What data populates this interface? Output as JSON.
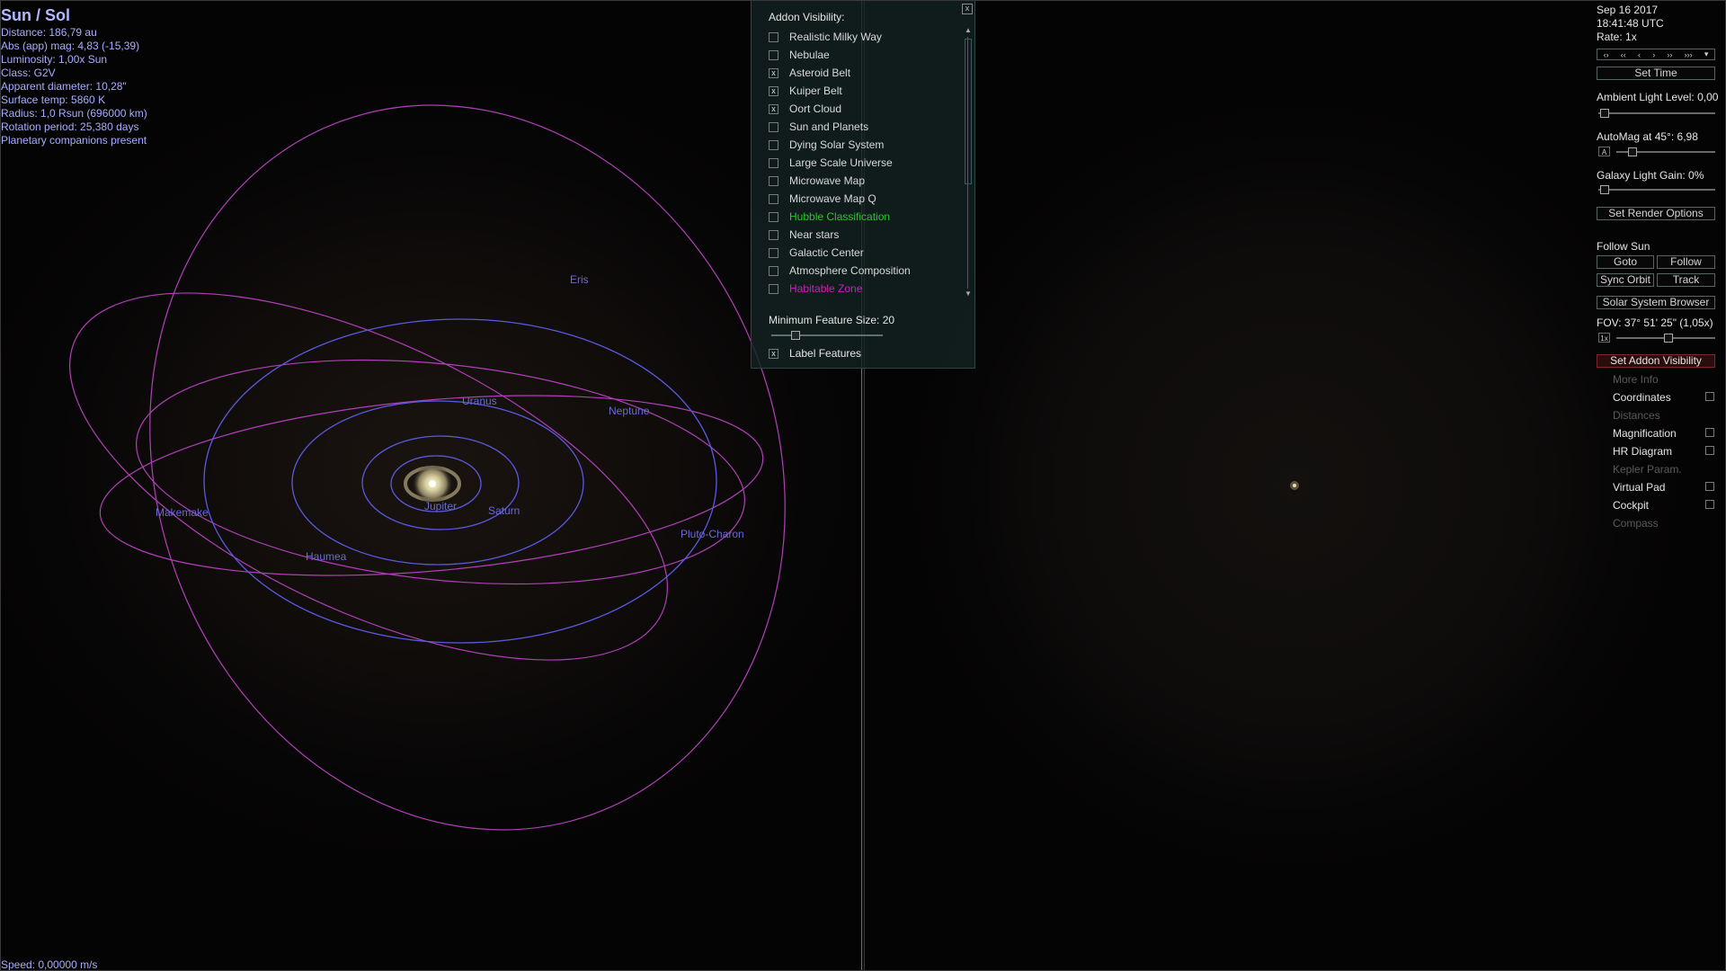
{
  "object_info": {
    "title": "Sun / Sol",
    "lines": [
      "Distance: 186,79 au",
      "Abs (app) mag: 4,83 (-15,39)",
      "Luminosity: 1,00x Sun",
      "Class: G2V",
      "Apparent diameter: 10,28\"",
      "Surface temp: 5860 K",
      "Radius: 1,0 Rsun  (696000 km)",
      "Rotation period: 25,380 days",
      "Planetary companions present"
    ]
  },
  "speed": "Speed: 0,00000 m/s",
  "orbit_labels": {
    "eris": "Eris",
    "uranus": "Uranus",
    "neptune": "Neptune",
    "jupiter": "Jupiter",
    "saturn": "Saturn",
    "makemake": "Makemake",
    "haumea": "Haumea",
    "pluto": "Pluto-Charon"
  },
  "colors": {
    "planet_orbit": "#5a5ae0",
    "dwarf_orbit": "#b040b8",
    "hubble": "#2ec42e",
    "habitable": "#d21cc0"
  },
  "addon_panel": {
    "heading": "Addon Visibility:",
    "close": "x",
    "items": [
      {
        "label": "Realistic Milky Way",
        "checked": false
      },
      {
        "label": "Nebulae",
        "checked": false
      },
      {
        "label": "Asteroid Belt",
        "checked": true
      },
      {
        "label": "Kuiper Belt",
        "checked": true
      },
      {
        "label": "Oort Cloud",
        "checked": true
      },
      {
        "label": "Sun and Planets",
        "checked": false
      },
      {
        "label": "Dying Solar System",
        "checked": false
      },
      {
        "label": "Large Scale Universe",
        "checked": false
      },
      {
        "label": "Microwave Map",
        "checked": false
      },
      {
        "label": "Microwave Map Q",
        "checked": false
      },
      {
        "label": "Hubble Classification",
        "checked": false,
        "color": "#2ec42e"
      },
      {
        "label": "Near stars",
        "checked": false
      },
      {
        "label": "Galactic Center",
        "checked": false
      },
      {
        "label": "Atmosphere Composition",
        "checked": false
      },
      {
        "label": "Habitable Zone",
        "checked": false,
        "color": "#d21cc0"
      }
    ],
    "min_feature_label": "Minimum Feature Size: 20",
    "label_features": {
      "label": "Label Features",
      "checked": true
    }
  },
  "control_panel": {
    "date": "Sep 16 2017",
    "time": "18:41:48  UTC",
    "rate": "Rate: 1x",
    "time_buttons": [
      "‹›",
      "‹‹",
      "‹",
      "›",
      "››",
      "›››",
      "▾"
    ],
    "set_time": "Set Time",
    "ambient": "Ambient Light Level: 0,00",
    "automag": "AutoMag at 45°: 6,98",
    "automag_box": "A",
    "galaxy_gain": "Galaxy Light Gain: 0%",
    "set_render": "Set Render Options",
    "follow_title": "Follow Sun",
    "goto": "Goto",
    "follow": "Follow",
    "sync_orbit": "Sync Orbit",
    "track": "Track",
    "solar_browser": "Solar System Browser",
    "fov": "FOV: 37° 51' 25\" (1,05x)",
    "fov_box": "1x",
    "set_addon": "Set Addon Visibility",
    "list": [
      {
        "label": "More Info",
        "enabled": false,
        "checkbox": false
      },
      {
        "label": "Coordinates",
        "enabled": true,
        "checkbox": true
      },
      {
        "label": "Distances",
        "enabled": false,
        "checkbox": false
      },
      {
        "label": "Magnification",
        "enabled": true,
        "checkbox": true
      },
      {
        "label": "HR Diagram",
        "enabled": true,
        "checkbox": true
      },
      {
        "label": "Kepler Param.",
        "enabled": false,
        "checkbox": false
      },
      {
        "label": "Virtual Pad",
        "enabled": true,
        "checkbox": true
      },
      {
        "label": "Cockpit",
        "enabled": true,
        "checkbox": true
      },
      {
        "label": "Compass",
        "enabled": false,
        "checkbox": false
      }
    ]
  }
}
